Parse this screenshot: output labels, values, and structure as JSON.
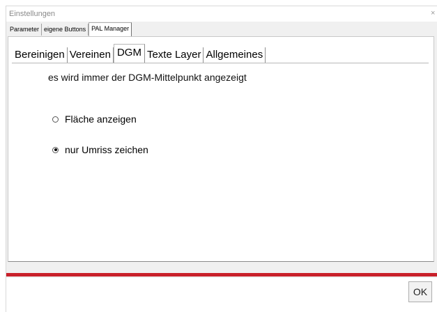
{
  "window": {
    "title": "Einstellungen",
    "close_glyph": "×"
  },
  "outer_tabs": [
    {
      "label": "Parameter",
      "active": false
    },
    {
      "label": "eigene Buttons",
      "active": false
    },
    {
      "label": "PAL Manager",
      "active": true
    }
  ],
  "inner_tabs": [
    {
      "label": "Bereinigen",
      "active": false
    },
    {
      "label": "Vereinen",
      "active": false
    },
    {
      "label": "DGM",
      "active": true
    },
    {
      "label": "Texte Layer",
      "active": false
    },
    {
      "label": "Allgemeines",
      "active": false
    }
  ],
  "dgm": {
    "info_text": "es wird immer der DGM-Mittelpunkt angezeigt",
    "options": [
      {
        "label": "Fläche anzeigen",
        "selected": false
      },
      {
        "label": "nur Umriss zeichen",
        "selected": true
      }
    ]
  },
  "footer": {
    "ok_label": "OK"
  },
  "colors": {
    "accent_bar": "#c8202a",
    "window_bg": "#f0f0f0",
    "panel_bg": "#ffffff"
  }
}
